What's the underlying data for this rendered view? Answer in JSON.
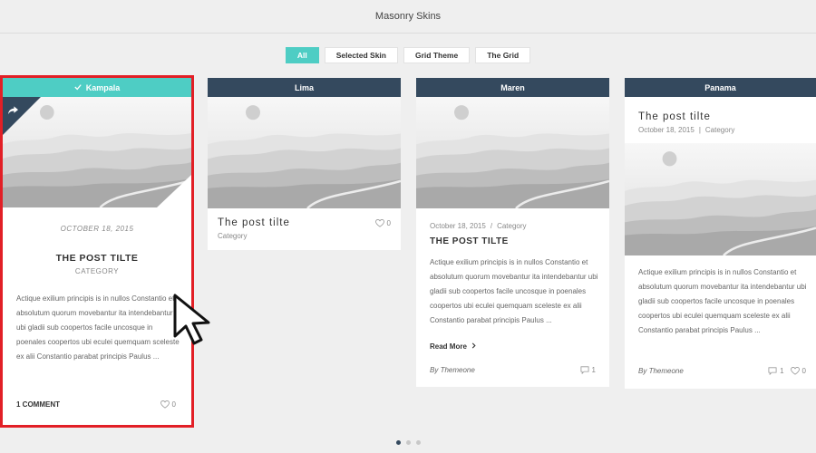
{
  "header": {
    "title": "Masonry Skins"
  },
  "filters": [
    {
      "label": "All",
      "active": true
    },
    {
      "label": "Selected Skin",
      "active": false
    },
    {
      "label": "Grid Theme",
      "active": false
    },
    {
      "label": "The Grid",
      "active": false
    }
  ],
  "cards": {
    "kampala": {
      "header": "Kampala",
      "date": "OCTOBER 18, 2015",
      "title": "THE POST TILTE",
      "category": "CATEGORY",
      "excerpt": "Actique exilium principis is in nullos Constantio et absolutum quorum movebantur ita intendebantur ubi gladii sub coopertos facile uncosque in poenales coopertos ubi eculei quemquam sceleste ex alii Constantio parabat principis Paulus ...",
      "comments": "1 COMMENT",
      "likes": "0"
    },
    "lima": {
      "header": "Lima",
      "title": "The post tilte",
      "category": "Category",
      "likes": "0"
    },
    "maren": {
      "header": "Maren",
      "date": "October 18, 2015",
      "sep": "/",
      "category": "Category",
      "title": "THE POST TILTE",
      "excerpt": "Actique exilium principis is in nullos Constantio et absolutum quorum movebantur ita intendebantur ubi gladii sub coopertos facile uncosque in poenales coopertos ubi eculei quemquam sceleste ex alii Constantio parabat principis Paulus ...",
      "read_more": "Read More",
      "author_prefix": "By",
      "author": "Themeone",
      "comments": "1"
    },
    "panama": {
      "header": "Panama",
      "title": "The post tilte",
      "date": "October 18, 2015",
      "sep": "|",
      "category": "Category",
      "excerpt": "Actique exilium principis is in nullos Constantio et absolutum quorum movebantur ita intendebantur ubi gladii sub coopertos facile uncosque in poenales coopertos ubi eculei quemquam sceleste ex alii Constantio parabat principis Paulus ...",
      "author_prefix": "By",
      "author": "Themeone",
      "comments": "1",
      "likes": "0"
    }
  },
  "pagination": {
    "pages": 3,
    "current": 1
  },
  "icons": [
    "check-icon",
    "share-icon",
    "heart-icon",
    "comment-icon",
    "chevron-right-icon",
    "mouse-cursor-icon"
  ],
  "colors": {
    "accent": "#4ecdc4",
    "header_dark": "#34495e",
    "highlight": "#e21f26"
  }
}
